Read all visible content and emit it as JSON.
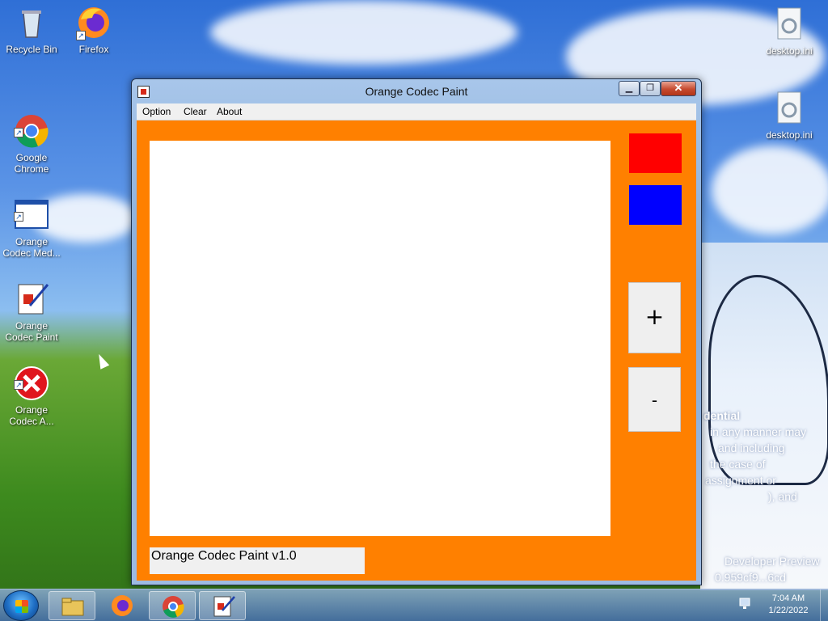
{
  "desktop": {
    "icons": [
      {
        "label": "Recycle Bin"
      },
      {
        "label": "Firefox"
      },
      {
        "label": "Google\nChrome"
      },
      {
        "label": "Orange\nCodec Med..."
      },
      {
        "label": "Orange\nCodec Paint"
      },
      {
        "label": "Orange\nCodec A..."
      },
      {
        "label": "desktop.ini"
      },
      {
        "label": "desktop.ini"
      }
    ],
    "wallpaper_text": [
      "dential",
      "in any manner may",
      "and including",
      "the case of",
      "assignment or",
      "), and",
      "Developer Preview",
      "0.959cf9...6cd"
    ]
  },
  "window": {
    "title": "Orange Codec Paint",
    "controls": {
      "minimize": "▁",
      "maximize": "❐",
      "close": "✕"
    },
    "menu": [
      "Option",
      "Clear",
      "About"
    ],
    "colors": {
      "background": "#ff8000",
      "swatch1": "#ff0000",
      "swatch2": "#0000ff",
      "canvas": "#ffffff"
    },
    "buttons": {
      "plus": "+",
      "minus": "-"
    },
    "status": "Orange Codec Paint v1.0"
  },
  "taskbar": {
    "time": "7:04 AM",
    "date": "1/22/2022"
  }
}
